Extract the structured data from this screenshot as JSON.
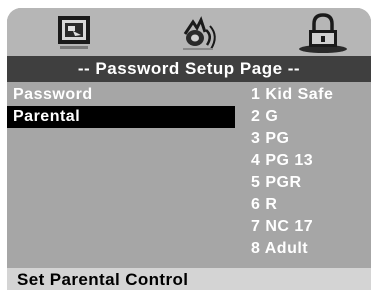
{
  "tabs": [
    {
      "icon": "setup-icon",
      "selected": false
    },
    {
      "icon": "audio-icon",
      "selected": false
    },
    {
      "icon": "lock-icon",
      "selected": true
    }
  ],
  "title": "-- Password Setup Page --",
  "menu": {
    "items": [
      {
        "label": "Password",
        "selected": false
      },
      {
        "label": "Parental",
        "selected": true
      }
    ]
  },
  "ratings": [
    "1 Kid Safe",
    "2 G",
    "3 PG",
    "4 PG 13",
    "5 PGR",
    "6 R",
    "7 NC 17",
    "8 Adult"
  ],
  "status": "Set Parental Control",
  "colors": {
    "background": "#a6a6a6",
    "tab_bar": "#b6b6b6",
    "title_bar": "#3f3f3f",
    "highlight": "#000000",
    "status_bar": "#d4d4d4"
  }
}
